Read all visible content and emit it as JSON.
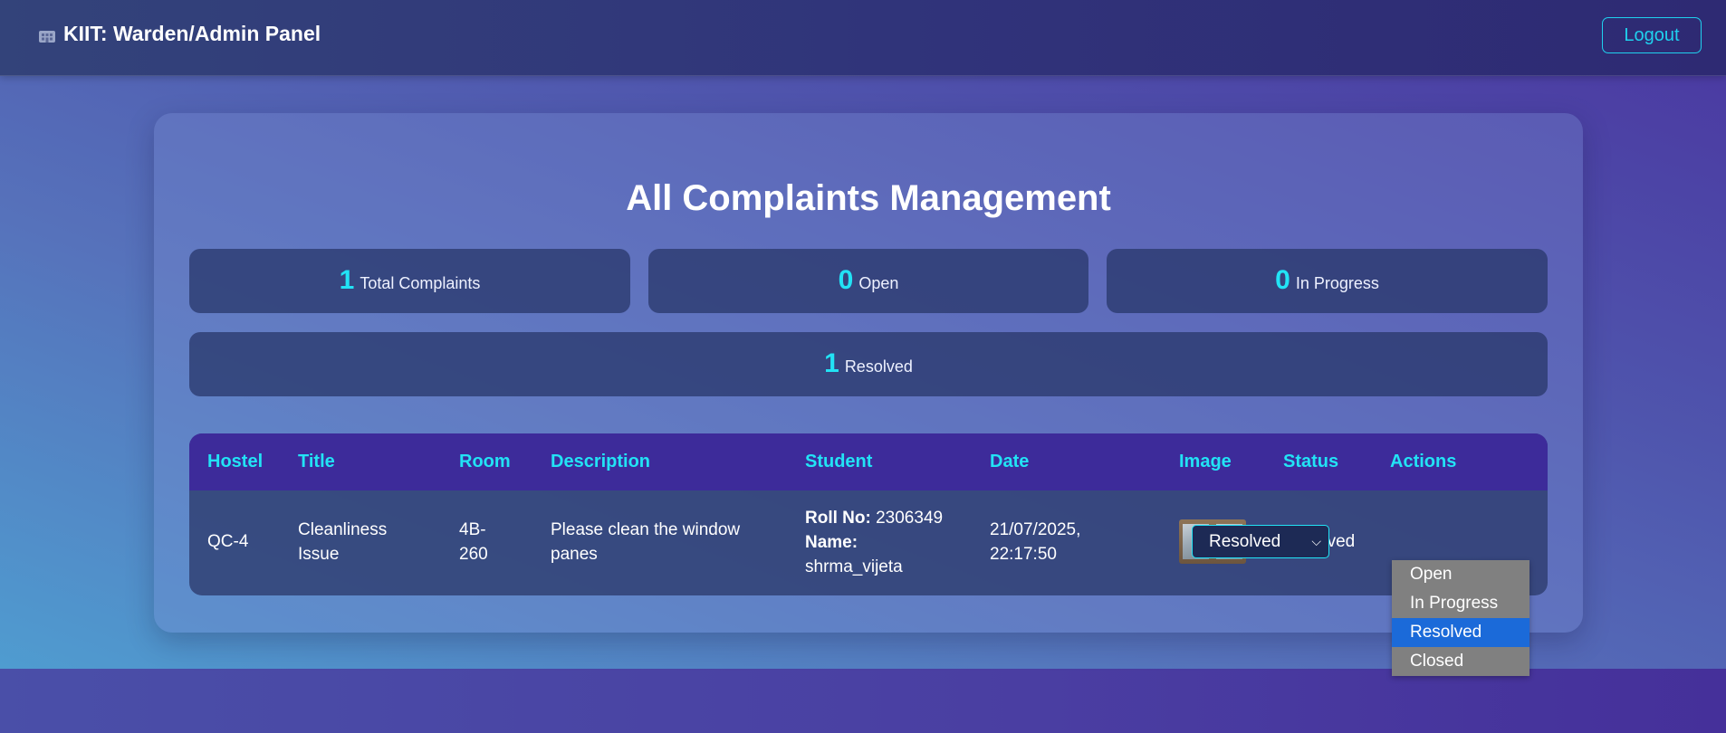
{
  "app": {
    "brand": "KIIT: Warden/Admin Panel",
    "brand_icon": "building-icon",
    "logout_label": "Logout"
  },
  "colors": {
    "accent": "#22e3f5",
    "header_bg": "#3d2b9a",
    "selected_option": "#1b6ad9"
  },
  "main": {
    "title": "All Complaints Management",
    "stats": [
      {
        "value": "1",
        "label": "Total Complaints"
      },
      {
        "value": "0",
        "label": "Open"
      },
      {
        "value": "0",
        "label": "In Progress"
      },
      {
        "value": "1",
        "label": "Resolved"
      }
    ]
  },
  "table": {
    "columns": [
      "Hostel",
      "Title",
      "Room",
      "Description",
      "Student",
      "Date",
      "Image",
      "Status",
      "Actions"
    ],
    "rows": [
      {
        "hostel": "QC-4",
        "title_line1": "Cleanliness",
        "title_line2": "Issue",
        "room_line1": "4B-",
        "room_line2": "260",
        "description_line1": "Please clean the window",
        "description_line2": "panes",
        "roll_label": "Roll No:",
        "roll_value": "2306349",
        "name_label": "Name:",
        "name_value": "shrma_vijeta",
        "date_line1": "21/07/2025,",
        "date_line2": "22:17:50",
        "image_icon": "window-photo-thumbnail",
        "status": "Resolved",
        "action_value": "Resolved"
      }
    ]
  },
  "dropdown": {
    "options": [
      "Open",
      "In Progress",
      "Resolved",
      "Closed"
    ],
    "selected": "Resolved"
  }
}
